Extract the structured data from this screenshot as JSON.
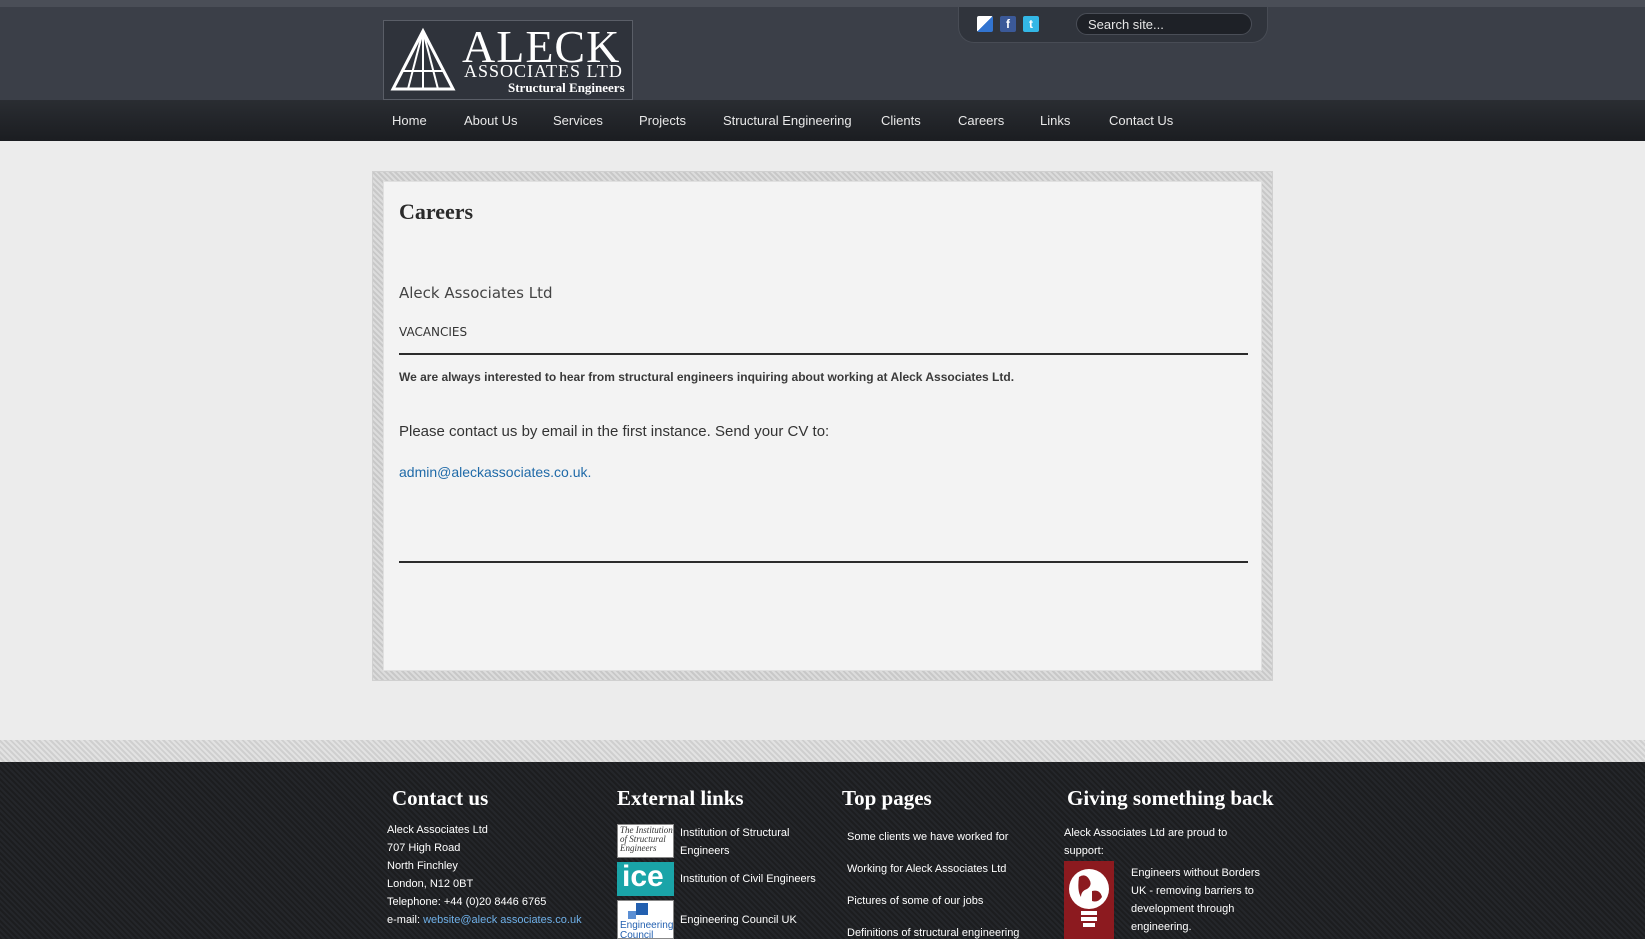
{
  "header": {
    "logo": {
      "title": "ALECK",
      "subtitle": "ASSOCIATES LTD",
      "tagline": "Structural Engineers"
    },
    "social": {
      "delicious_icon": "delicious-icon",
      "facebook_icon": "facebook-icon",
      "twitter_icon": "twitter-icon"
    },
    "search": {
      "placeholder": "Search site..."
    }
  },
  "nav": {
    "items": [
      {
        "label": "Home"
      },
      {
        "label": "About Us"
      },
      {
        "label": "Services"
      },
      {
        "label": "Projects"
      },
      {
        "label": "Structural Engineering"
      },
      {
        "label": "Clients"
      },
      {
        "label": "Careers"
      },
      {
        "label": "Links"
      },
      {
        "label": "Contact Us"
      }
    ]
  },
  "main": {
    "title": "Careers",
    "company": "Aleck Associates Ltd",
    "section": "VACANCIES",
    "intro": "We are always interested to hear from structural engineers inquiring about working at Aleck Associates Ltd.",
    "contact_line": "Please contact us by email in the first instance. Send your CV to:",
    "email": "admin@aleckassociates.co.uk",
    "email_suffix": "."
  },
  "footer": {
    "contact": {
      "heading": "Contact us",
      "lines": [
        "Aleck Associates Ltd",
        "707 High Road",
        "North Finchley",
        "London, N12 0BT",
        "Telephone: +44 (0)20 8446 6765"
      ],
      "email_label": "e-mail: ",
      "email": "website@aleck associates.co.uk"
    },
    "external": {
      "heading": "External links",
      "items": [
        {
          "label_line1": "Institution of Structural",
          "label_line2": "Engineers",
          "logo_text": "The Institution of Structural Engineers"
        },
        {
          "label_line1": "Institution of Civil Engineers",
          "logo_text": "ice"
        },
        {
          "label_line1": "Engineering Council UK",
          "logo_text": "Engineering Council"
        }
      ]
    },
    "top_pages": {
      "heading": "Top pages",
      "items": [
        "Some clients we have worked for",
        "Working for Aleck Associates Ltd",
        "Pictures of some of our jobs",
        "Definitions of structural engineering"
      ]
    },
    "giving": {
      "heading": "Giving something back",
      "intro_line1": "Aleck Associates Ltd are proud to",
      "intro_line2": "support:",
      "desc_lines": [
        "Engineers without Borders",
        "UK - removing barriers to",
        "development through",
        "engineering."
      ]
    }
  },
  "colors": {
    "header_bg": "#3b3f48",
    "nav_bg": "#1b1d21",
    "link": "#1f6aa8",
    "footer_bg": "#1c1d1f"
  }
}
